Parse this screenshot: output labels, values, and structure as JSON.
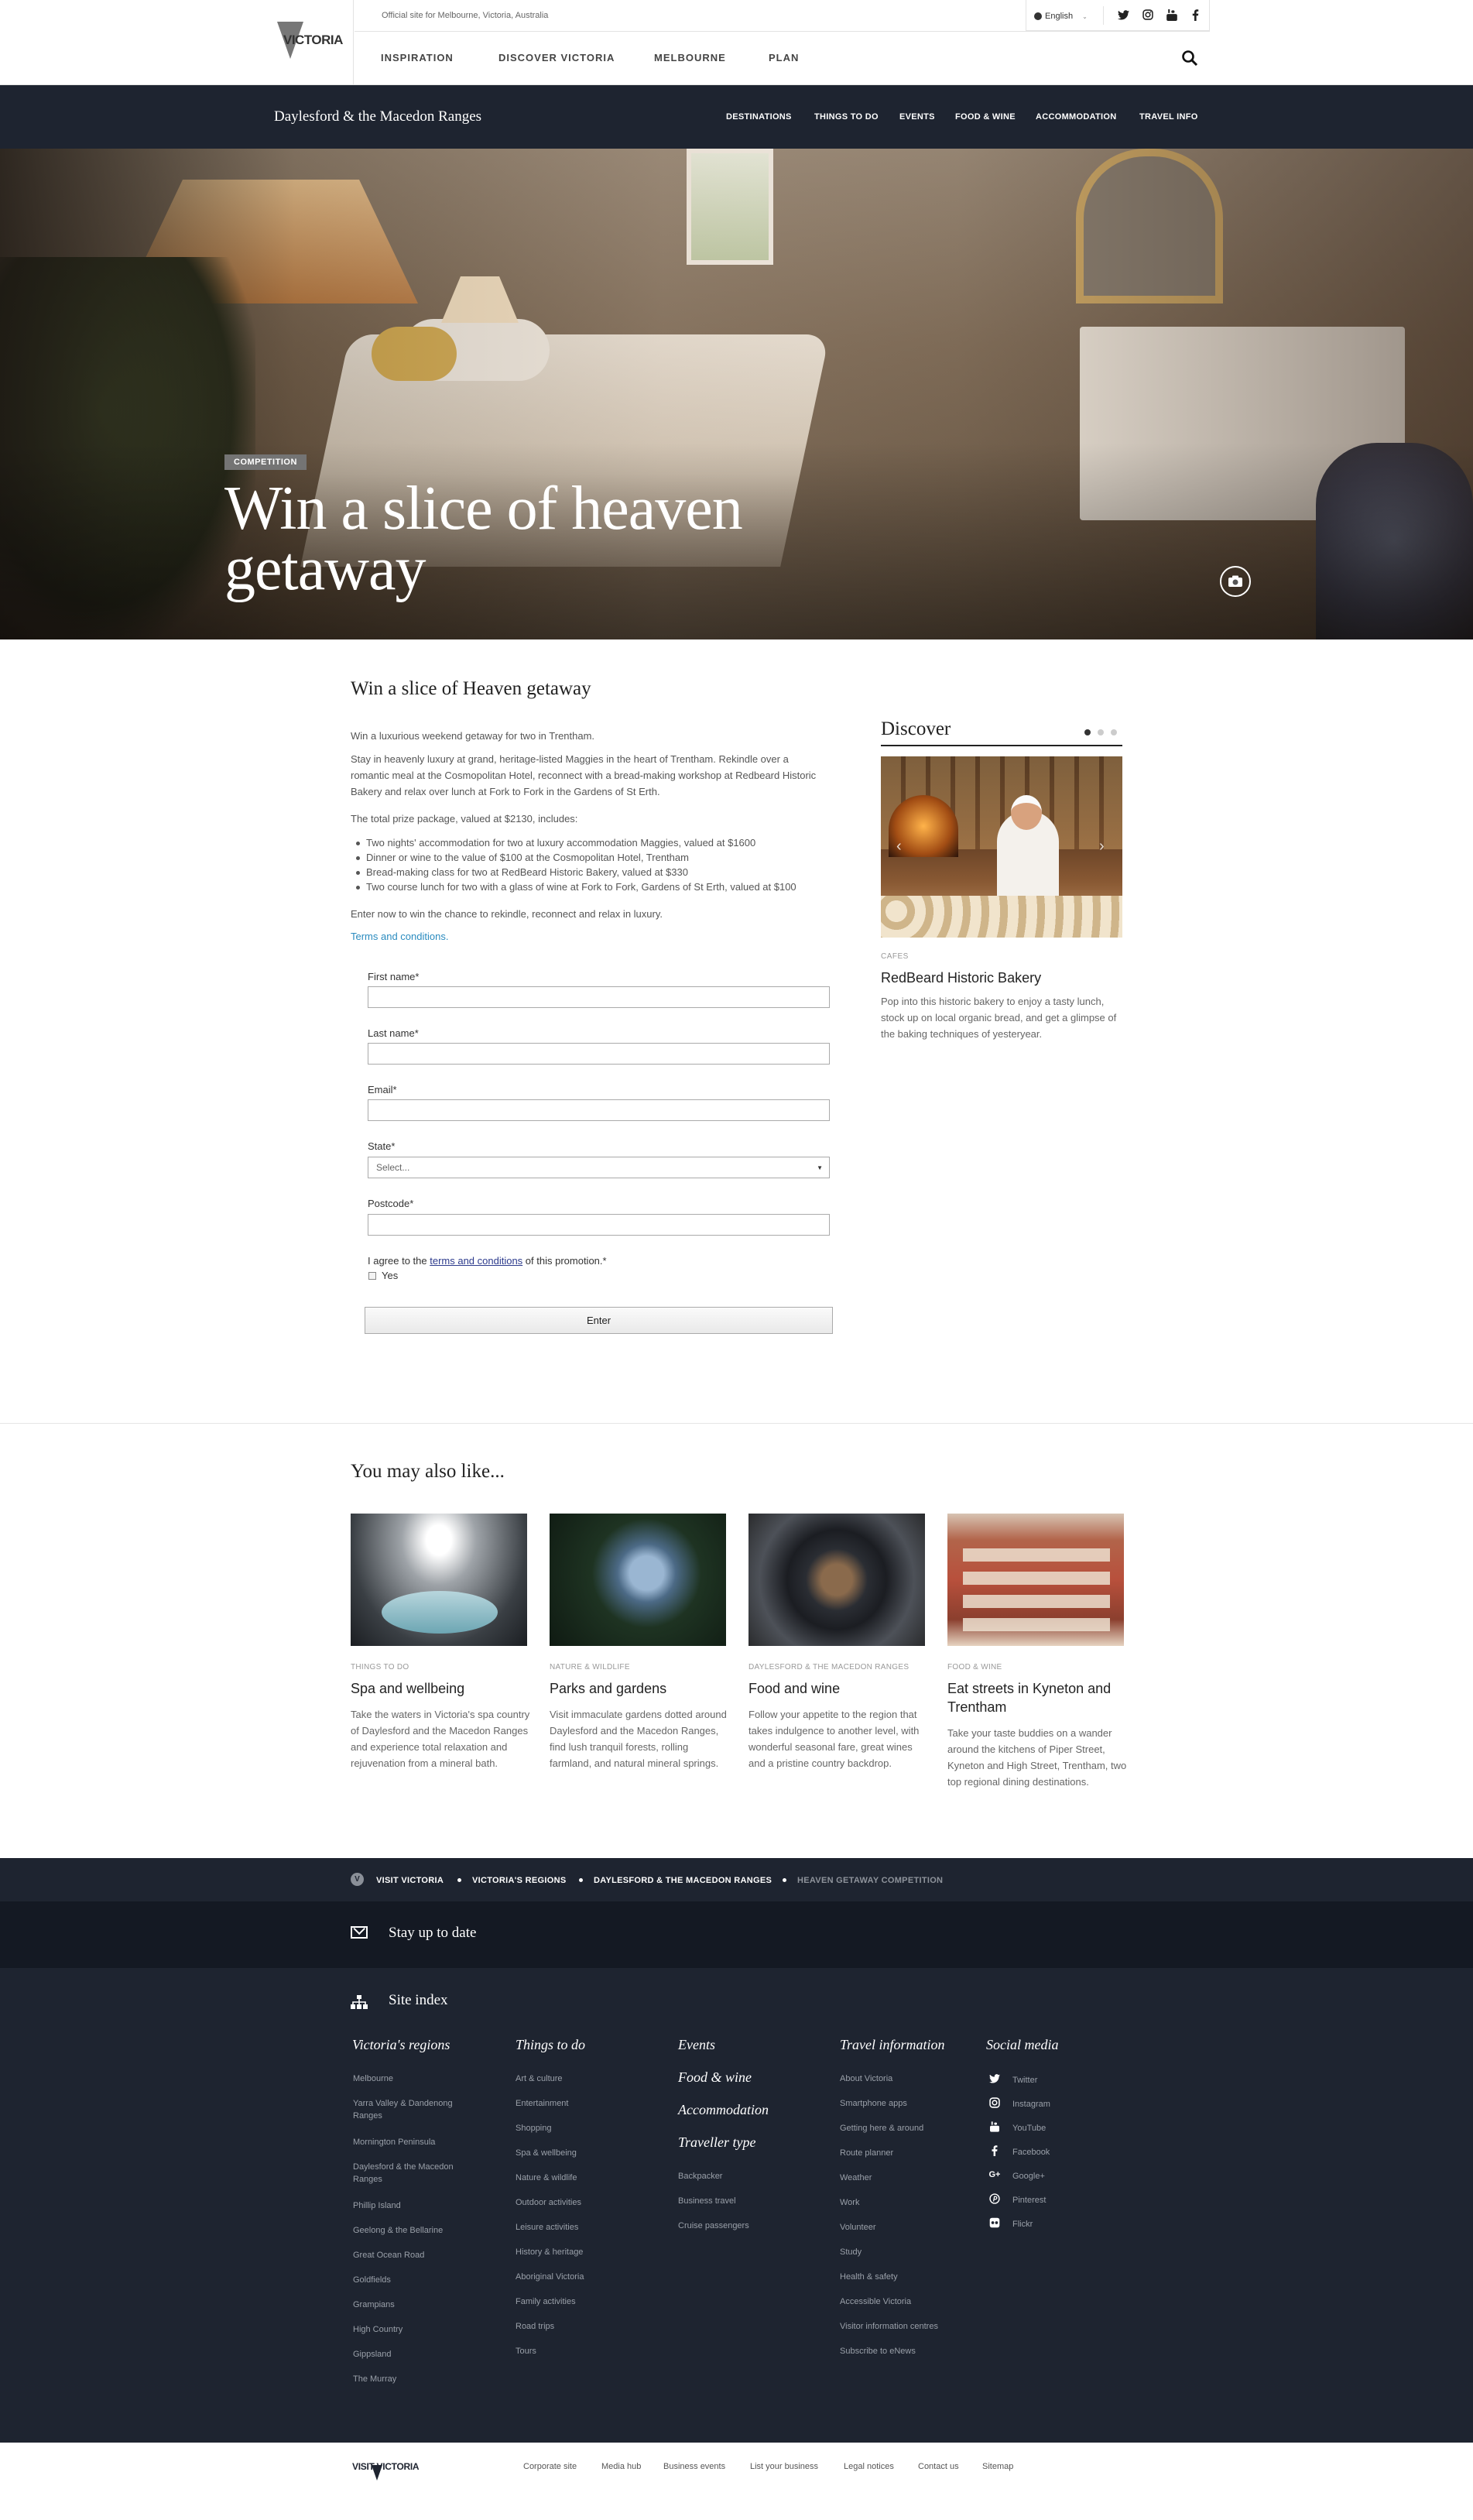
{
  "header": {
    "logo_text": "VICTORIA",
    "official_text": "Official site for Melbourne, Victoria, Australia",
    "language": "English",
    "nav": [
      "INSPIRATION",
      "DISCOVER VICTORIA",
      "MELBOURNE",
      "PLAN"
    ]
  },
  "region_nav": {
    "title": "Daylesford & the Macedon Ranges",
    "links": [
      "DESTINATIONS",
      "THINGS TO DO",
      "EVENTS",
      "FOOD & WINE",
      "ACCOMMODATION",
      "TRAVEL INFO"
    ]
  },
  "hero": {
    "badge": "COMPETITION",
    "title": "Win a slice of heaven getaway"
  },
  "article": {
    "heading": "Win a slice of Heaven getaway",
    "intro": "Win a luxurious weekend getaway for two in Trentham.",
    "paragraph": "Stay in heavenly luxury at grand, heritage-listed Maggies in the heart of Trentham. Rekindle over a romantic meal at the Cosmopolitan Hotel, reconnect with a bread-making workshop at Redbeard Historic Bakery and relax over lunch at Fork to Fork in the Gardens of St Erth.",
    "package_intro": "The total prize package, valued at $2130, includes:",
    "prizes": [
      "Two nights' accommodation for two at luxury accommodation Maggies, valued at $1600",
      "Dinner or wine to the value of $100 at the Cosmopolitan Hotel, Trentham",
      "Bread-making class for two at RedBeard Historic Bakery, valued at $330",
      "Two course lunch for two with a glass of wine at Fork to Fork, Gardens of St Erth, valued at $100"
    ],
    "closing": "Enter now to win the chance to rekindle, reconnect and relax in luxury.",
    "terms_link": "Terms and conditions."
  },
  "form": {
    "first_name_label": "First name*",
    "last_name_label": "Last name*",
    "email_label": "Email*",
    "state_label": "State*",
    "state_value": "Select...",
    "postcode_label": "Postcode*",
    "agree_prefix": "I agree to the ",
    "agree_link": "terms and conditions",
    "agree_suffix": " of this promotion.*",
    "yes_label": "Yes",
    "submit_label": "Enter"
  },
  "discover": {
    "heading": "Discover",
    "category": "CAFES",
    "title": "RedBeard Historic Bakery",
    "text": "Pop into this historic bakery to enjoy a tasty lunch, stock up on local organic bread, and get a glimpse of the baking techniques of yesteryear."
  },
  "also_like": {
    "heading": "You may also like...",
    "cards": [
      {
        "category": "THINGS TO DO",
        "title": "Spa and wellbeing",
        "text": "Take the waters in Victoria's spa country of Daylesford and the Macedon Ranges and experience total relaxation and rejuvenation from a mineral bath."
      },
      {
        "category": "NATURE & WILDLIFE",
        "title": "Parks and gardens",
        "text": "Visit immaculate gardens dotted around Daylesford and the Macedon Ranges, find lush tranquil forests, rolling farmland, and natural mineral springs."
      },
      {
        "category": "DAYLESFORD & THE MACEDON RANGES",
        "title": "Food and wine",
        "text": "Follow your appetite to the region that takes indulgence to another level, with wonderful seasonal fare, great wines and a pristine country backdrop."
      },
      {
        "category": "FOOD & WINE",
        "title": "Eat streets in Kyneton and Trentham",
        "text": "Take your taste buddies on a wander around the kitchens of Piper Street, Kyneton and High Street, Trentham, two top regional dining destinations."
      }
    ]
  },
  "breadcrumb": [
    "VISIT VICTORIA",
    "VICTORIA'S REGIONS",
    "DAYLESFORD & THE MACEDON RANGES",
    "HEAVEN GETAWAY COMPETITION"
  ],
  "newsletter": {
    "text": "Stay up to date"
  },
  "site_index": {
    "heading": "Site index",
    "regions_heading": "Victoria's regions",
    "regions": [
      "Melbourne",
      "Yarra Valley & Dandenong Ranges",
      "Mornington Peninsula",
      "Daylesford & the Macedon Ranges",
      "Phillip Island",
      "Geelong & the Bellarine",
      "Great Ocean Road",
      "Goldfields",
      "Grampians",
      "High Country",
      "Gippsland",
      "The Murray"
    ],
    "things_heading": "Things to do",
    "things": [
      "Art & culture",
      "Entertainment",
      "Shopping",
      "Spa & wellbeing",
      "Nature & wildlife",
      "Outdoor activities",
      "Leisure activities",
      "History & heritage",
      "Aboriginal Victoria",
      "Family activities",
      "Road trips",
      "Tours"
    ],
    "col3_headings": [
      "Events",
      "Food & wine",
      "Accommodation",
      "Traveller type"
    ],
    "traveller": [
      "Backpacker",
      "Business travel",
      "Cruise passengers"
    ],
    "travel_heading": "Travel information",
    "travel": [
      "About Victoria",
      "Smartphone apps",
      "Getting here & around",
      "Route planner",
      "Weather",
      "Work",
      "Volunteer",
      "Study",
      "Health & safety",
      "Accessible Victoria",
      "Visitor information centres",
      "Subscribe to eNews"
    ],
    "social_heading": "Social media",
    "social": [
      "Twitter",
      "Instagram",
      "YouTube",
      "Facebook",
      "Google+",
      "Pinterest",
      "Flickr"
    ]
  },
  "bottom_footer": {
    "logo": "VISIT VICTORIA",
    "links": [
      "Corporate site",
      "Media hub",
      "Business events",
      "List your business",
      "Legal notices",
      "Contact us",
      "Sitemap"
    ]
  },
  "colors": {
    "dark_navy": "#1e2430",
    "link_blue": "#2a8bbf"
  }
}
